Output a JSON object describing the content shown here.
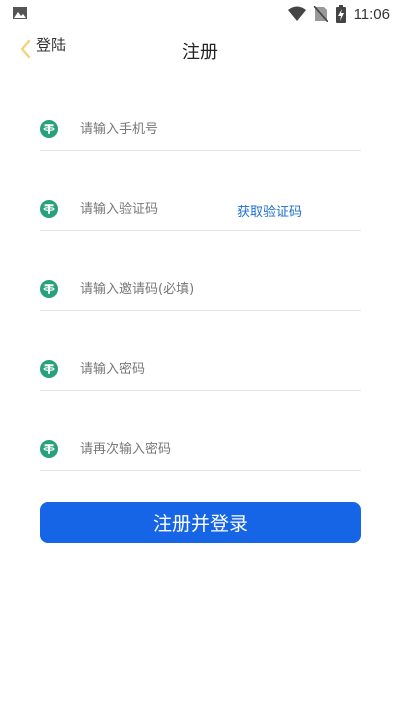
{
  "status_bar": {
    "time": "11:06",
    "icons": [
      "image-icon",
      "wifi-icon",
      "no-sim-icon",
      "battery-charging-icon"
    ]
  },
  "nav": {
    "back_label": "登陆",
    "title": "注册"
  },
  "form": {
    "phone_placeholder": "请输入手机号",
    "code_placeholder": "请输入验证码",
    "get_code_label": "获取验证码",
    "invite_placeholder": "请输入邀请码(必填)",
    "password_placeholder": "请输入密码",
    "confirm_placeholder": "请再次输入密码",
    "field_icon": "tether-coin-icon",
    "icon_color": "#26a17b"
  },
  "submit_label": "注册并登录",
  "colors": {
    "primary": "#1565e6",
    "link": "#1a6fd0",
    "back_arrow": "#f3d37a"
  }
}
